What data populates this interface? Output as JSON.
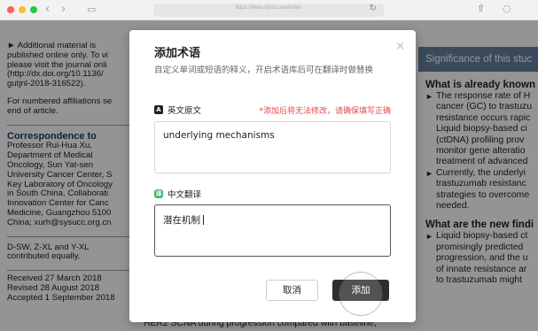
{
  "browser": {
    "url": "https://www.vljsci.com/index",
    "back_icon": "chevron-left-icon",
    "forward_icon": "chevron-right-icon",
    "traffic_colors": [
      "#ff5f57",
      "#febc2e",
      "#28c840"
    ]
  },
  "article": {
    "left_lines": [
      "► Additional material is",
      "published online only. To vi",
      "please visit the journal onli",
      "(http://dx.doi.org/10.1136/",
      "gutjnl-2018-316522)."
    ],
    "affil_lines": [
      "For numbered affiliations se",
      "end of article."
    ],
    "correspondence_heading": "Correspondence to",
    "correspondence_lines": [
      "Professor Rui-Hua Xu,",
      "Department of Medical",
      "Oncology, Sun Yat-sen",
      "University Cancer Center, S",
      "Key Laboratory of Oncology",
      "in South China, Collaborati",
      "Innovation Center for Canc",
      "Medicine, Guangzhou 5100",
      "China; xurh@sysucc.org.cn"
    ],
    "contrib_lines": [
      "D-SW, Z-XL and Y-XL",
      "contributed equally."
    ],
    "dates": [
      "Received 27 March 2018",
      "Revised 28 August 2018",
      "Accepted 1 September 2018"
    ],
    "bottom_lines": [
      "HER2 SCNA during progression compared with baseline,"
    ],
    "significance_title": "Significance of this stuc",
    "known_heading": "What is already known",
    "known_items": [
      [
        "The response rate of H",
        "cancer (GC) to trastuzu",
        "resistance occurs rapic",
        "Liquid biopsy-based ci",
        "(ctDNA) profiling prov",
        "monitor gene alteratio",
        "treatment of advanced"
      ],
      [
        "Currently, the underlyi",
        "trastuzumab resistanc",
        "strategies to overcome",
        "needed."
      ]
    ],
    "new_heading": "What are the new findi",
    "new_items": [
      [
        "Liquid biopsy-based ct",
        "promisingly predicted",
        "progression, and the u",
        "of innate resistance ar",
        "to trastuzumab might"
      ]
    ]
  },
  "dialog": {
    "title": "添加术语",
    "subtitle": "自定义单词或短语的释义，开启术语库后可在翻译时做替换",
    "close_label": "×",
    "source_badge": "A",
    "source_label": "英文原文",
    "warning": "*添加后将无法修改，请确保填写正确",
    "source_value": "underlying mechanisms",
    "target_badge": "译",
    "target_label": "中文翻译",
    "target_value": "潜在机制",
    "cancel_label": "取消",
    "add_label": "添加"
  }
}
